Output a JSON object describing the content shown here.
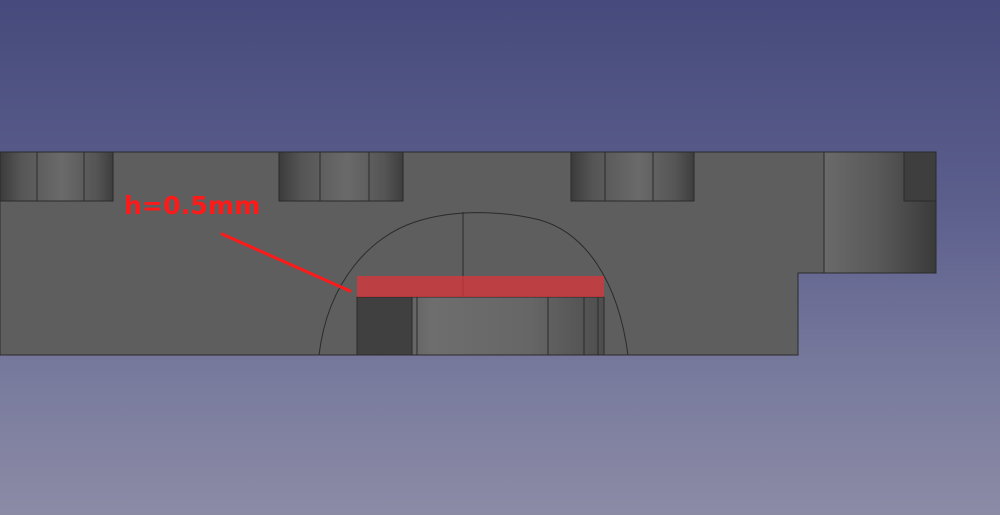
{
  "viewer": {
    "annotation": {
      "label": "h=0.5mm",
      "color": "#ff1a1a",
      "highlight_color": "#e0333a"
    },
    "part_colors": {
      "face": "#5e5e5e",
      "edge": "#2a2a2a",
      "bore_dark": "#3a3a3a",
      "bore_light": "#6c6c6c"
    }
  }
}
